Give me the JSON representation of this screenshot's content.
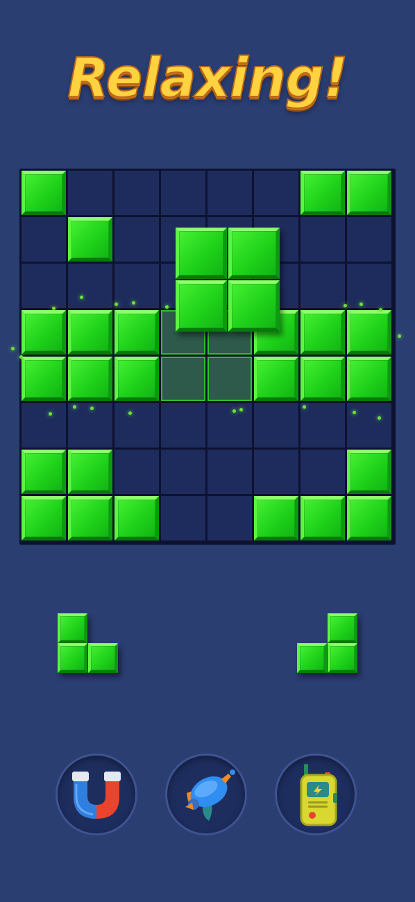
{
  "banner": {
    "text": "Relaxing!"
  },
  "board": {
    "cols": 8,
    "rows": 8,
    "filled": [
      [
        0,
        0
      ],
      [
        6,
        0
      ],
      [
        7,
        0
      ],
      [
        1,
        1
      ],
      [
        0,
        3
      ],
      [
        1,
        3
      ],
      [
        2,
        3
      ],
      [
        5,
        3
      ],
      [
        6,
        3
      ],
      [
        7,
        3
      ],
      [
        0,
        4
      ],
      [
        1,
        4
      ],
      [
        2,
        4
      ],
      [
        5,
        4
      ],
      [
        6,
        4
      ],
      [
        7,
        4
      ],
      [
        0,
        6
      ],
      [
        1,
        6
      ],
      [
        7,
        6
      ],
      [
        0,
        7
      ],
      [
        1,
        7
      ],
      [
        2,
        7
      ],
      [
        5,
        7
      ],
      [
        6,
        7
      ],
      [
        7,
        7
      ]
    ],
    "preview_cells": [
      [
        3,
        3
      ],
      [
        4,
        3
      ],
      [
        3,
        4
      ],
      [
        4,
        4
      ]
    ]
  },
  "dragging_piece": {
    "shape": "square-2x2"
  },
  "tray": [
    {
      "shape": "L-corner",
      "cells": [
        [
          0,
          0
        ],
        [
          0,
          1
        ],
        [
          1,
          1
        ]
      ]
    },
    {
      "shape": "J-corner",
      "cells": [
        [
          1,
          0
        ],
        [
          0,
          1
        ],
        [
          1,
          1
        ]
      ]
    }
  ],
  "boosters": [
    {
      "name": "magnet-booster",
      "icon": "magnet-icon"
    },
    {
      "name": "rocket-booster",
      "icon": "rocket-icon"
    },
    {
      "name": "walkie-talkie-booster",
      "icon": "walkie-talkie-icon"
    }
  ],
  "colors": {
    "background": "#2b3e72",
    "block_green": "#22d41c",
    "banner_yellow": "#ffd23f"
  }
}
